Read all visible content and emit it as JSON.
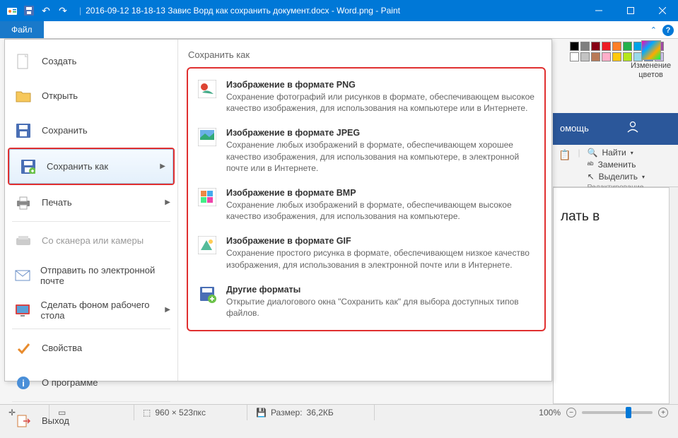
{
  "titlebar": {
    "title": "2016-09-12 18-18-13 Завис Ворд как сохранить документ.docx - Word.png - Paint"
  },
  "file_tab": "Файл",
  "menu": {
    "create": "Создать",
    "open": "Открыть",
    "save": "Сохранить",
    "save_as": "Сохранить как",
    "print": "Печать",
    "scanner": "Со сканера или камеры",
    "email": "Отправить по электронной почте",
    "wallpaper": "Сделать фоном рабочего стола",
    "properties": "Свойства",
    "about": "О программе",
    "exit": "Выход"
  },
  "submenu": {
    "heading": "Сохранить как",
    "png": {
      "title": "Изображение в формате PNG",
      "desc": "Сохранение фотографий или рисунков в формате, обеспечивающем высокое качество изображения, для использования на компьютере или в Интернете."
    },
    "jpeg": {
      "title": "Изображение в формате JPEG",
      "desc": "Сохранение любых изображений в формате, обеспечивающем хорошее качество изображения, для использования на компьютере, в электронной почте или в Интернете."
    },
    "bmp": {
      "title": "Изображение в формате BMP",
      "desc": "Сохранение любых изображений в формате, обеспечивающем высокое качество изображения, для использования на компьютере."
    },
    "gif": {
      "title": "Изображение в формате GIF",
      "desc": "Сохранение простого рисунка в формате, обеспечивающем низкое качество изображения, для использования в электронной почте или в Интернете."
    },
    "other": {
      "title": "Другие форматы",
      "desc": "Открытие диалогового окна \"Сохранить как\" для выбора доступных типов файлов."
    }
  },
  "colors_group": {
    "edit_colors": "Изменение\nцветов",
    "swatches_top": [
      "#000000",
      "#7f7f7f",
      "#880015",
      "#ed1c24",
      "#ff7f27",
      "#22b14c",
      "#00a2e8",
      "#3f48cc",
      "#a349a4"
    ],
    "swatches_bot": [
      "#ffffff",
      "#c3c3c3",
      "#b97a57",
      "#ffaec9",
      "#ffc90e",
      "#b5e61d",
      "#99d9ea",
      "#7092be",
      "#c8bfe7"
    ]
  },
  "word_bg": {
    "help_tab": "омощь",
    "find": "Найти",
    "replace": "Заменить",
    "select": "Выделить",
    "group": "Редактирование",
    "doc_text": "лать в"
  },
  "statusbar": {
    "canvas_size": "960 × 523пкс",
    "file_size_label": "Размер:",
    "file_size": "36,2КБ",
    "zoom": "100%"
  }
}
